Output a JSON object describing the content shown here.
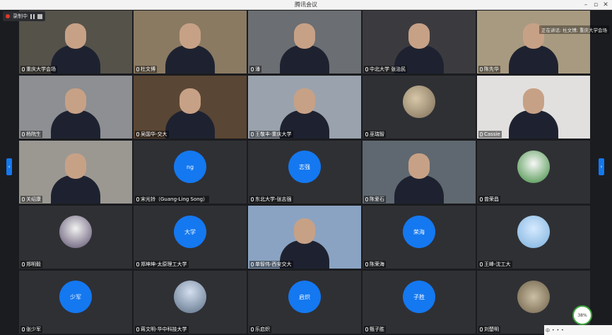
{
  "window": {
    "title": "腾讯会议"
  },
  "recording": {
    "label": "录制中"
  },
  "speaking": {
    "text": "正在讲话: 杜文博; 重庆大学会场"
  },
  "tiles": [
    {
      "name": "重庆大学会场",
      "kind": "video"
    },
    {
      "name": "杜文博",
      "kind": "video"
    },
    {
      "name": "潘",
      "kind": "video"
    },
    {
      "name": "中北大学 张治民",
      "kind": "video"
    },
    {
      "name": "陈先华",
      "kind": "video"
    },
    {
      "name": "杨院生",
      "kind": "video"
    },
    {
      "name": "吴国华-交大",
      "kind": "video"
    },
    {
      "name": "王敬丰-重庆大学",
      "kind": "video"
    },
    {
      "name": "巫瑞智",
      "kind": "image-avatar"
    },
    {
      "name": "Cassie",
      "kind": "video"
    },
    {
      "name": "关绍康",
      "kind": "video"
    },
    {
      "name": "宋光铃（Guang-Ling Song）",
      "kind": "text-avatar",
      "avatar": "ng"
    },
    {
      "name": "东北大学-张志强",
      "kind": "text-avatar",
      "avatar": "志强"
    },
    {
      "name": "陈爱石",
      "kind": "video"
    },
    {
      "name": "曾荣昌",
      "kind": "image-avatar"
    },
    {
      "name": "郑明毅",
      "kind": "image-avatar"
    },
    {
      "name": "郑坤坤-太原理工大学",
      "kind": "text-avatar",
      "avatar": "大学"
    },
    {
      "name": "单智伟-西安交大",
      "kind": "video"
    },
    {
      "name": "陈荣海",
      "kind": "text-avatar",
      "avatar": "荣海"
    },
    {
      "name": "王峰-沈工大",
      "kind": "image-avatar"
    },
    {
      "name": "张少军",
      "kind": "text-avatar",
      "avatar": "少军"
    },
    {
      "name": "蒋文明-华中科技大学",
      "kind": "image-avatar"
    },
    {
      "name": "乐启炽",
      "kind": "text-avatar",
      "avatar": "启炽"
    },
    {
      "name": "甄子胜",
      "kind": "text-avatar",
      "avatar": "子胜"
    },
    {
      "name": "刘楚明",
      "kind": "image-avatar"
    }
  ],
  "network": {
    "percent": "38%"
  },
  "taskbar": {
    "ime": "中"
  },
  "icons": {
    "left_arrow": "‹",
    "right_arrow": "›"
  }
}
